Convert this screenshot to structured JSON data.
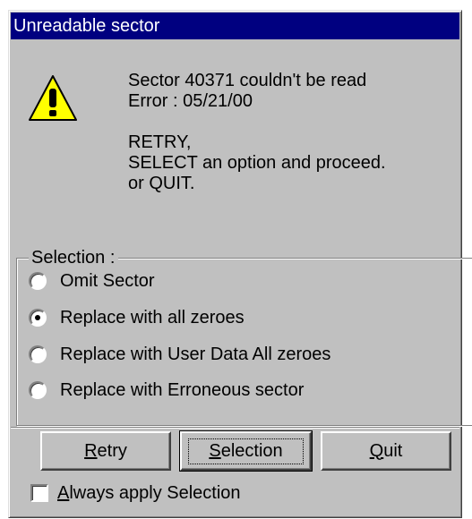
{
  "window": {
    "title": "Unreadable sector"
  },
  "message": {
    "icon": "warning-icon",
    "line1": "Sector 40371 couldn't be read",
    "line2": "Error : 05/21/00",
    "line3": "RETRY,",
    "line4": "SELECT an option and proceed.",
    "line5": "or QUIT."
  },
  "selection": {
    "legend": "Selection :",
    "options": [
      {
        "label": "Omit Sector",
        "checked": false
      },
      {
        "label": "Replace with all zeroes",
        "checked": true
      },
      {
        "label": "Replace with User Data All zeroes",
        "checked": false
      },
      {
        "label": "Replace with Erroneous sector",
        "checked": false
      }
    ]
  },
  "buttons": {
    "retry_mnemonic": "R",
    "retry_rest": "etry",
    "selection_mnemonic": "S",
    "selection_rest": "election",
    "quit_mnemonic": "Q",
    "quit_rest": "uit"
  },
  "always_apply": {
    "mnemonic": "A",
    "rest": "lways apply Selection",
    "checked": false
  },
  "colors": {
    "titlebar": "#000080",
    "face": "#c0c0c0",
    "warning_fill": "#ffff00"
  }
}
